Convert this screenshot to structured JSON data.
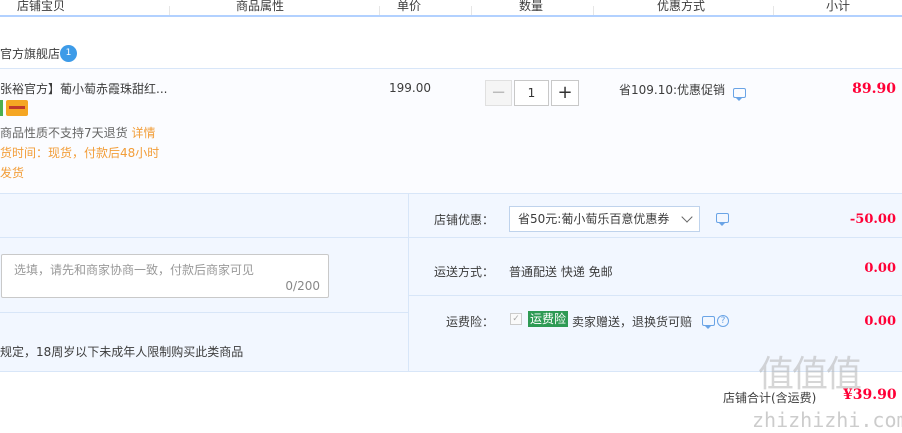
{
  "header": {
    "col_item": "店铺宝贝",
    "col_attr": "商品属性",
    "col_price": "单价",
    "col_qty": "数量",
    "col_promo": "优惠方式",
    "col_subtotal": "小计"
  },
  "shop": {
    "name": "官方旗舰店",
    "ww_glyph": "1"
  },
  "item": {
    "title": "张裕官方】葡小萄赤霞珠甜红...",
    "policy": "商品性质不支持7天退货",
    "policy_link": "详情",
    "ship_time": "货时间：现货，付款后48小时",
    "ship_now": "发货",
    "unit_price": "199.00",
    "quantity": "1",
    "qty_minus": "−",
    "qty_plus": "+",
    "promo_text": "省109.10:优惠促销",
    "subtotal": "89.90"
  },
  "order": {
    "coupon_label": "店铺优惠：",
    "coupon_value": "省50元:葡小萄乐百意优惠券",
    "coupon_amount": "-50.00",
    "shipping_label": "运送方式：",
    "shipping_value": "普通配送 快递 免邮",
    "shipping_amount": "0.00",
    "insurance_label": "运费险：",
    "insurance_check": "✓",
    "insurance_tag": "运费险",
    "insurance_value": "卖家赠送，退换货可赔",
    "insurance_help": "?",
    "insurance_amount": "0.00",
    "memo_placeholder": "选填，请先和商家协商一致，付款后商家可见",
    "memo_count": "0/200",
    "law_notice": "规定，18周岁以下未成年人限制购买此类商品"
  },
  "total": {
    "label": "店铺合计(含运费)",
    "amount": "¥39.90"
  },
  "watermark": {
    "glyphs": "值值值",
    "domain": "zhizhizhi.com"
  },
  "colors": {
    "accent_red": "#ff0036",
    "link_orange": "#f29d38",
    "header_line": "#b2d1ff",
    "panel_bg": "#f2f7ff"
  }
}
